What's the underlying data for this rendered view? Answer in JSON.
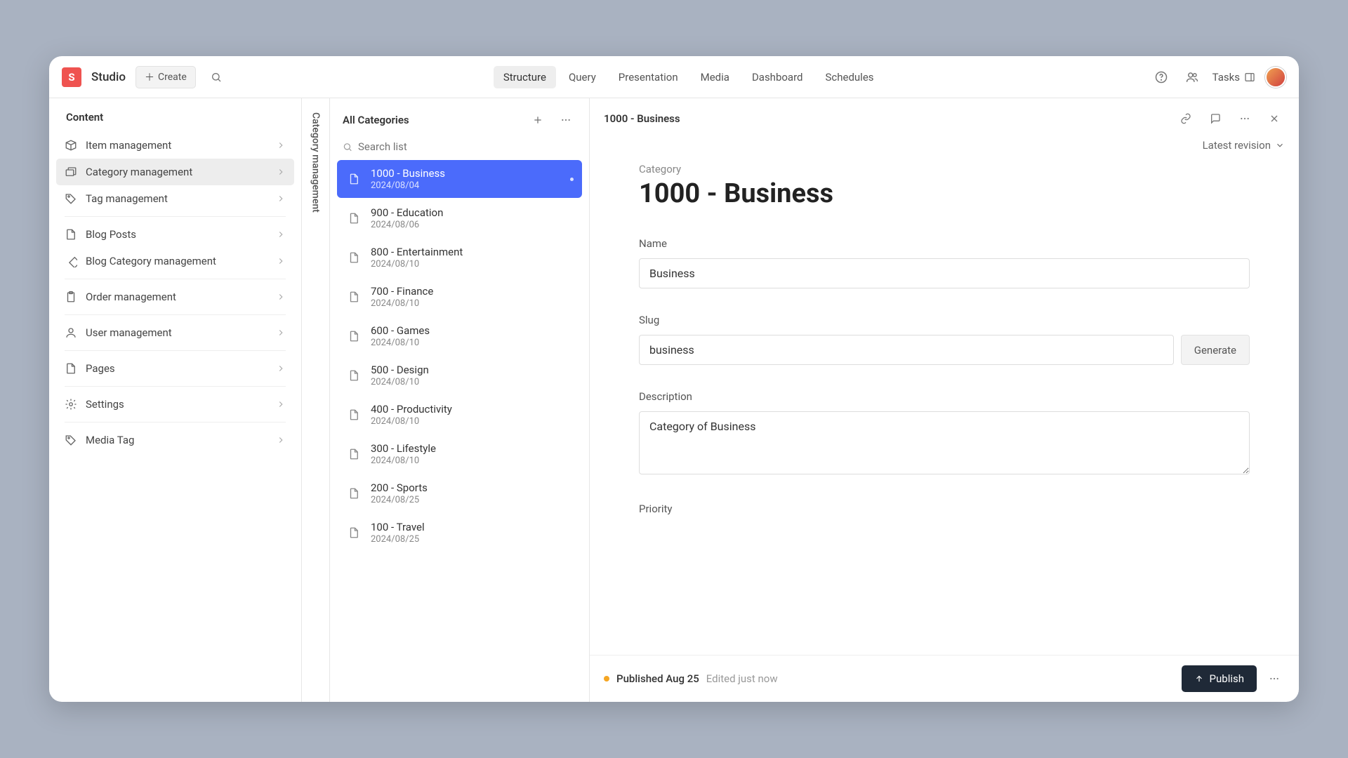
{
  "topbar": {
    "brand": "Studio",
    "create_label": "Create",
    "nav": [
      {
        "label": "Structure",
        "active": true
      },
      {
        "label": "Query",
        "active": false
      },
      {
        "label": "Presentation",
        "active": false
      },
      {
        "label": "Media",
        "active": false
      },
      {
        "label": "Dashboard",
        "active": false
      },
      {
        "label": "Schedules",
        "active": false
      }
    ],
    "tasks_label": "Tasks"
  },
  "sidebar": {
    "header": "Content",
    "items": [
      {
        "label": "Item management",
        "icon": "box",
        "active": false
      },
      {
        "label": "Category management",
        "icon": "folders",
        "active": true
      },
      {
        "label": "Tag management",
        "icon": "tag",
        "active": false
      },
      {
        "label": "Blog Posts",
        "icon": "doc",
        "divider_before": true,
        "active": false
      },
      {
        "label": "Blog Category management",
        "icon": "diamond",
        "active": false
      },
      {
        "label": "Order management",
        "icon": "clipboard",
        "divider_before": true,
        "active": false
      },
      {
        "label": "User management",
        "icon": "user",
        "divider_before": true,
        "active": false
      },
      {
        "label": "Pages",
        "icon": "doc",
        "divider_before": true,
        "active": false
      },
      {
        "label": "Settings",
        "icon": "gear",
        "divider_before": true,
        "active": false
      },
      {
        "label": "Media Tag",
        "icon": "tag",
        "divider_before": true,
        "active": false
      }
    ]
  },
  "vtab": {
    "label": "Category management"
  },
  "midlist": {
    "title": "All Categories",
    "search_placeholder": "Search list",
    "items": [
      {
        "title": "1000 - Business",
        "date": "2024/08/04",
        "active": true
      },
      {
        "title": "900 - Education",
        "date": "2024/08/06",
        "active": false
      },
      {
        "title": "800 - Entertainment",
        "date": "2024/08/10",
        "active": false
      },
      {
        "title": "700 - Finance",
        "date": "2024/08/10",
        "active": false
      },
      {
        "title": "600 - Games",
        "date": "2024/08/10",
        "active": false
      },
      {
        "title": "500 - Design",
        "date": "2024/08/10",
        "active": false
      },
      {
        "title": "400 - Productivity",
        "date": "2024/08/10",
        "active": false
      },
      {
        "title": "300 - Lifestyle",
        "date": "2024/08/10",
        "active": false
      },
      {
        "title": "200 - Sports",
        "date": "2024/08/25",
        "active": false
      },
      {
        "title": "100 - Travel",
        "date": "2024/08/25",
        "active": false
      }
    ]
  },
  "editor": {
    "header_title": "1000 - Business",
    "revision_label": "Latest revision",
    "category_label": "Category",
    "category_title": "1000 - Business",
    "fields": {
      "name_label": "Name",
      "name_value": "Business",
      "slug_label": "Slug",
      "slug_value": "business",
      "generate_label": "Generate",
      "description_label": "Description",
      "description_value": "Category of Business",
      "priority_label": "Priority"
    },
    "footer": {
      "published": "Published Aug 25",
      "edited": "Edited just now",
      "publish_label": "Publish"
    }
  }
}
